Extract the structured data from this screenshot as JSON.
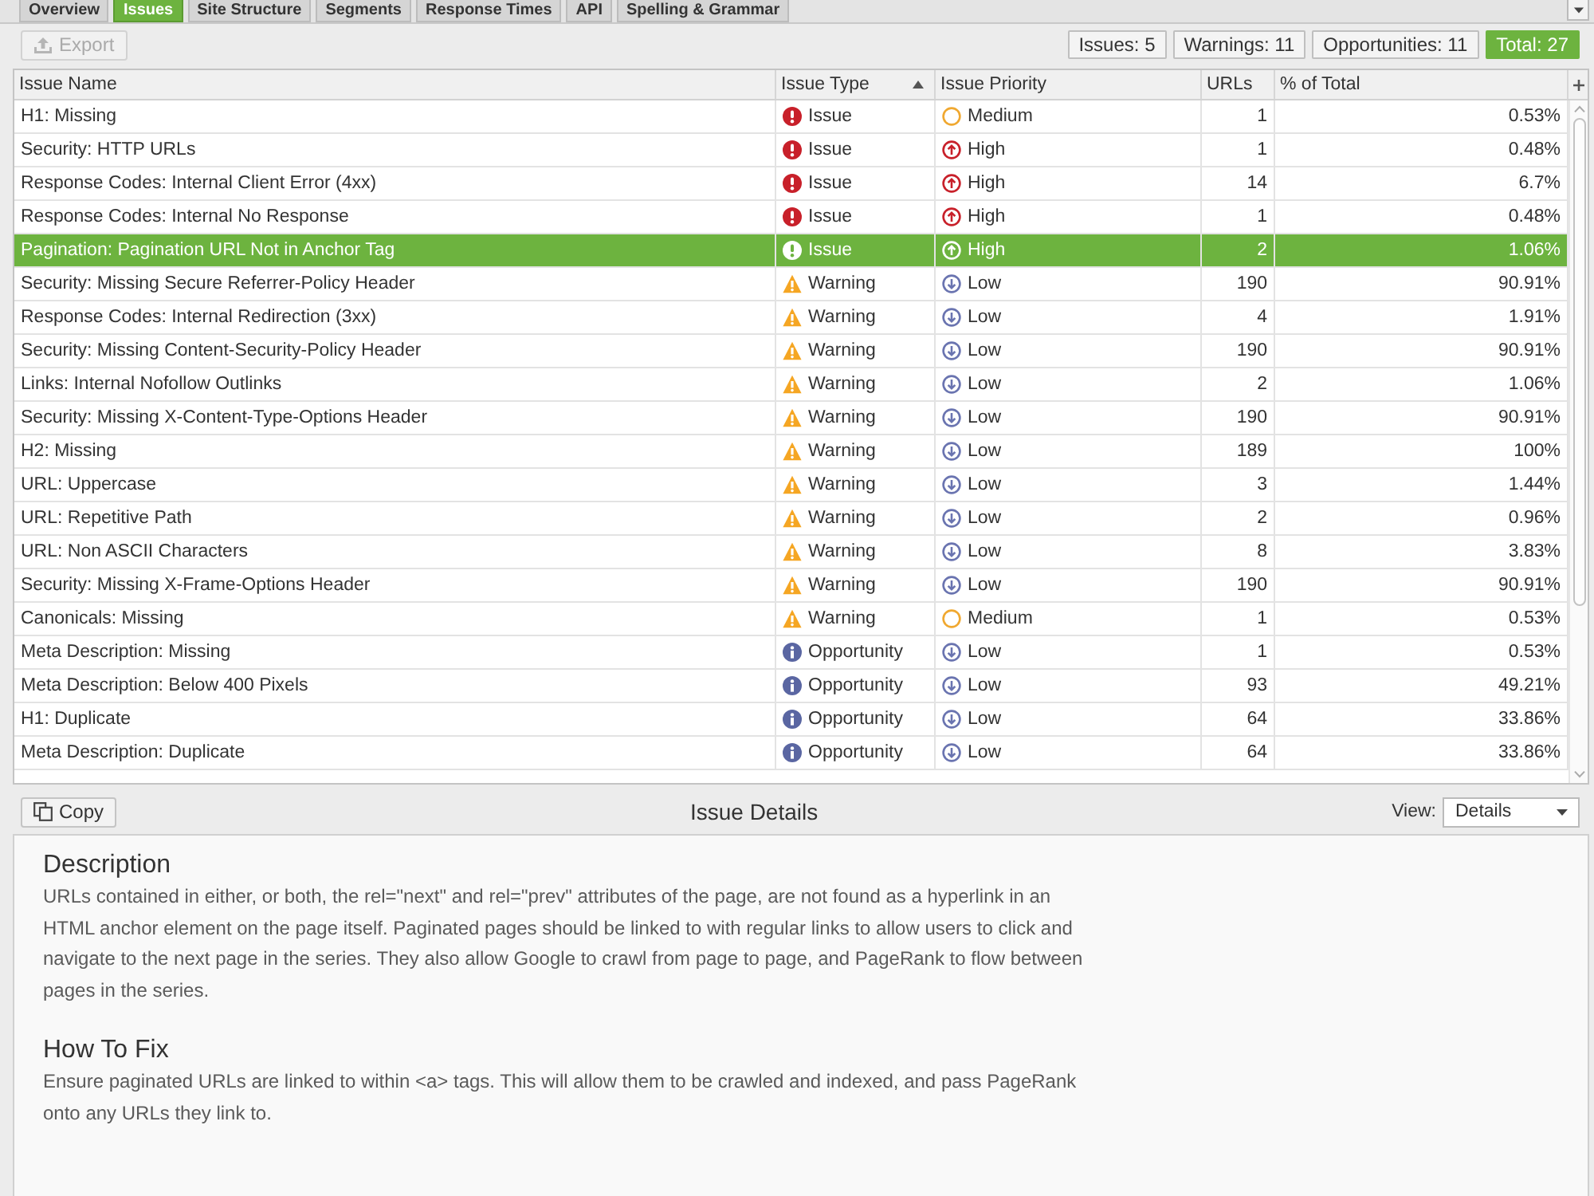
{
  "tabs": [
    {
      "label": "Overview",
      "selected": false
    },
    {
      "label": "Issues",
      "selected": true
    },
    {
      "label": "Site Structure",
      "selected": false
    },
    {
      "label": "Segments",
      "selected": false
    },
    {
      "label": "Response Times",
      "selected": false
    },
    {
      "label": "API",
      "selected": false
    },
    {
      "label": "Spelling & Grammar",
      "selected": false
    }
  ],
  "toolbar": {
    "export_button": {
      "label": "Export",
      "disabled": true
    },
    "counters": [
      {
        "label": "Issues: 5",
        "selected": false
      },
      {
        "label": "Warnings: 11",
        "selected": false
      },
      {
        "label": "Opportunities: 11",
        "selected": false
      },
      {
        "label": "Total: 27",
        "selected": true
      }
    ]
  },
  "table": {
    "columns": [
      {
        "label": "Issue Name",
        "sorted_ascending": false
      },
      {
        "label": "Issue Type",
        "sorted_ascending": true
      },
      {
        "label": "Issue Priority",
        "sorted_ascending": false
      },
      {
        "label": "URLs",
        "sorted_ascending": false
      },
      {
        "label": "% of Total",
        "sorted_ascending": false
      }
    ],
    "rows": [
      {
        "selected": false,
        "issue_name": "H1: Missing",
        "type": {
          "kind": "issue",
          "label": "Issue"
        },
        "priority": {
          "kind": "medium",
          "label": "Medium"
        },
        "urls": "1",
        "percent_of_total": "0.53%"
      },
      {
        "selected": false,
        "issue_name": "Security: HTTP URLs",
        "type": {
          "kind": "issue",
          "label": "Issue"
        },
        "priority": {
          "kind": "high",
          "label": "High"
        },
        "urls": "1",
        "percent_of_total": "0.48%"
      },
      {
        "selected": false,
        "issue_name": "Response Codes: Internal Client Error (4xx)",
        "type": {
          "kind": "issue",
          "label": "Issue"
        },
        "priority": {
          "kind": "high",
          "label": "High"
        },
        "urls": "14",
        "percent_of_total": "6.7%"
      },
      {
        "selected": false,
        "issue_name": "Response Codes: Internal No Response",
        "type": {
          "kind": "issue",
          "label": "Issue"
        },
        "priority": {
          "kind": "high",
          "label": "High"
        },
        "urls": "1",
        "percent_of_total": "0.48%"
      },
      {
        "selected": true,
        "issue_name": "Pagination: Pagination URL Not in Anchor Tag",
        "type": {
          "kind": "issue",
          "label": "Issue"
        },
        "priority": {
          "kind": "high",
          "label": "High"
        },
        "urls": "2",
        "percent_of_total": "1.06%"
      },
      {
        "selected": false,
        "issue_name": "Security: Missing Secure Referrer-Policy Header",
        "type": {
          "kind": "warning",
          "label": "Warning"
        },
        "priority": {
          "kind": "low",
          "label": "Low"
        },
        "urls": "190",
        "percent_of_total": "90.91%"
      },
      {
        "selected": false,
        "issue_name": "Response Codes: Internal Redirection (3xx)",
        "type": {
          "kind": "warning",
          "label": "Warning"
        },
        "priority": {
          "kind": "low",
          "label": "Low"
        },
        "urls": "4",
        "percent_of_total": "1.91%"
      },
      {
        "selected": false,
        "issue_name": "Security: Missing Content-Security-Policy Header",
        "type": {
          "kind": "warning",
          "label": "Warning"
        },
        "priority": {
          "kind": "low",
          "label": "Low"
        },
        "urls": "190",
        "percent_of_total": "90.91%"
      },
      {
        "selected": false,
        "issue_name": "Links: Internal Nofollow Outlinks",
        "type": {
          "kind": "warning",
          "label": "Warning"
        },
        "priority": {
          "kind": "low",
          "label": "Low"
        },
        "urls": "2",
        "percent_of_total": "1.06%"
      },
      {
        "selected": false,
        "issue_name": "Security: Missing X-Content-Type-Options Header",
        "type": {
          "kind": "warning",
          "label": "Warning"
        },
        "priority": {
          "kind": "low",
          "label": "Low"
        },
        "urls": "190",
        "percent_of_total": "90.91%"
      },
      {
        "selected": false,
        "issue_name": "H2: Missing",
        "type": {
          "kind": "warning",
          "label": "Warning"
        },
        "priority": {
          "kind": "low",
          "label": "Low"
        },
        "urls": "189",
        "percent_of_total": "100%"
      },
      {
        "selected": false,
        "issue_name": "URL: Uppercase",
        "type": {
          "kind": "warning",
          "label": "Warning"
        },
        "priority": {
          "kind": "low",
          "label": "Low"
        },
        "urls": "3",
        "percent_of_total": "1.44%"
      },
      {
        "selected": false,
        "issue_name": "URL: Repetitive Path",
        "type": {
          "kind": "warning",
          "label": "Warning"
        },
        "priority": {
          "kind": "low",
          "label": "Low"
        },
        "urls": "2",
        "percent_of_total": "0.96%"
      },
      {
        "selected": false,
        "issue_name": "URL: Non ASCII Characters",
        "type": {
          "kind": "warning",
          "label": "Warning"
        },
        "priority": {
          "kind": "low",
          "label": "Low"
        },
        "urls": "8",
        "percent_of_total": "3.83%"
      },
      {
        "selected": false,
        "issue_name": "Security: Missing X-Frame-Options Header",
        "type": {
          "kind": "warning",
          "label": "Warning"
        },
        "priority": {
          "kind": "low",
          "label": "Low"
        },
        "urls": "190",
        "percent_of_total": "90.91%"
      },
      {
        "selected": false,
        "issue_name": "Canonicals: Missing",
        "type": {
          "kind": "warning",
          "label": "Warning"
        },
        "priority": {
          "kind": "medium",
          "label": "Medium"
        },
        "urls": "1",
        "percent_of_total": "0.53%"
      },
      {
        "selected": false,
        "issue_name": "Meta Description: Missing",
        "type": {
          "kind": "opportunity",
          "label": "Opportunity"
        },
        "priority": {
          "kind": "low",
          "label": "Low"
        },
        "urls": "1",
        "percent_of_total": "0.53%"
      },
      {
        "selected": false,
        "issue_name": "Meta Description: Below 400 Pixels",
        "type": {
          "kind": "opportunity",
          "label": "Opportunity"
        },
        "priority": {
          "kind": "low",
          "label": "Low"
        },
        "urls": "93",
        "percent_of_total": "49.21%"
      },
      {
        "selected": false,
        "issue_name": "H1: Duplicate",
        "type": {
          "kind": "opportunity",
          "label": "Opportunity"
        },
        "priority": {
          "kind": "low",
          "label": "Low"
        },
        "urls": "64",
        "percent_of_total": "33.86%"
      },
      {
        "selected": false,
        "issue_name": "Meta Description: Duplicate",
        "type": {
          "kind": "opportunity",
          "label": "Opportunity"
        },
        "priority": {
          "kind": "low",
          "label": "Low"
        },
        "urls": "64",
        "percent_of_total": "33.86%"
      }
    ]
  },
  "details": {
    "copy_button": "Copy",
    "title": "Issue Details",
    "view": {
      "label": "View:",
      "value": "Details"
    },
    "sections": [
      {
        "heading": "Description",
        "text": "URLs contained in either, or both, the rel=\"next\" and rel=\"prev\" attributes of the page, are not found as a hyperlink in an HTML anchor element on the page itself. Paginated pages should be linked to with regular links to allow users to click and navigate to the next page in the series. They also allow Google to crawl from page to page, and PageRank to flow between pages in the series."
      },
      {
        "heading": "How To Fix",
        "text": "Ensure paginated URLs are linked to within <a> tags. This will allow them to be crawled and indexed, and pass PageRank onto any URLs they link to."
      }
    ]
  }
}
